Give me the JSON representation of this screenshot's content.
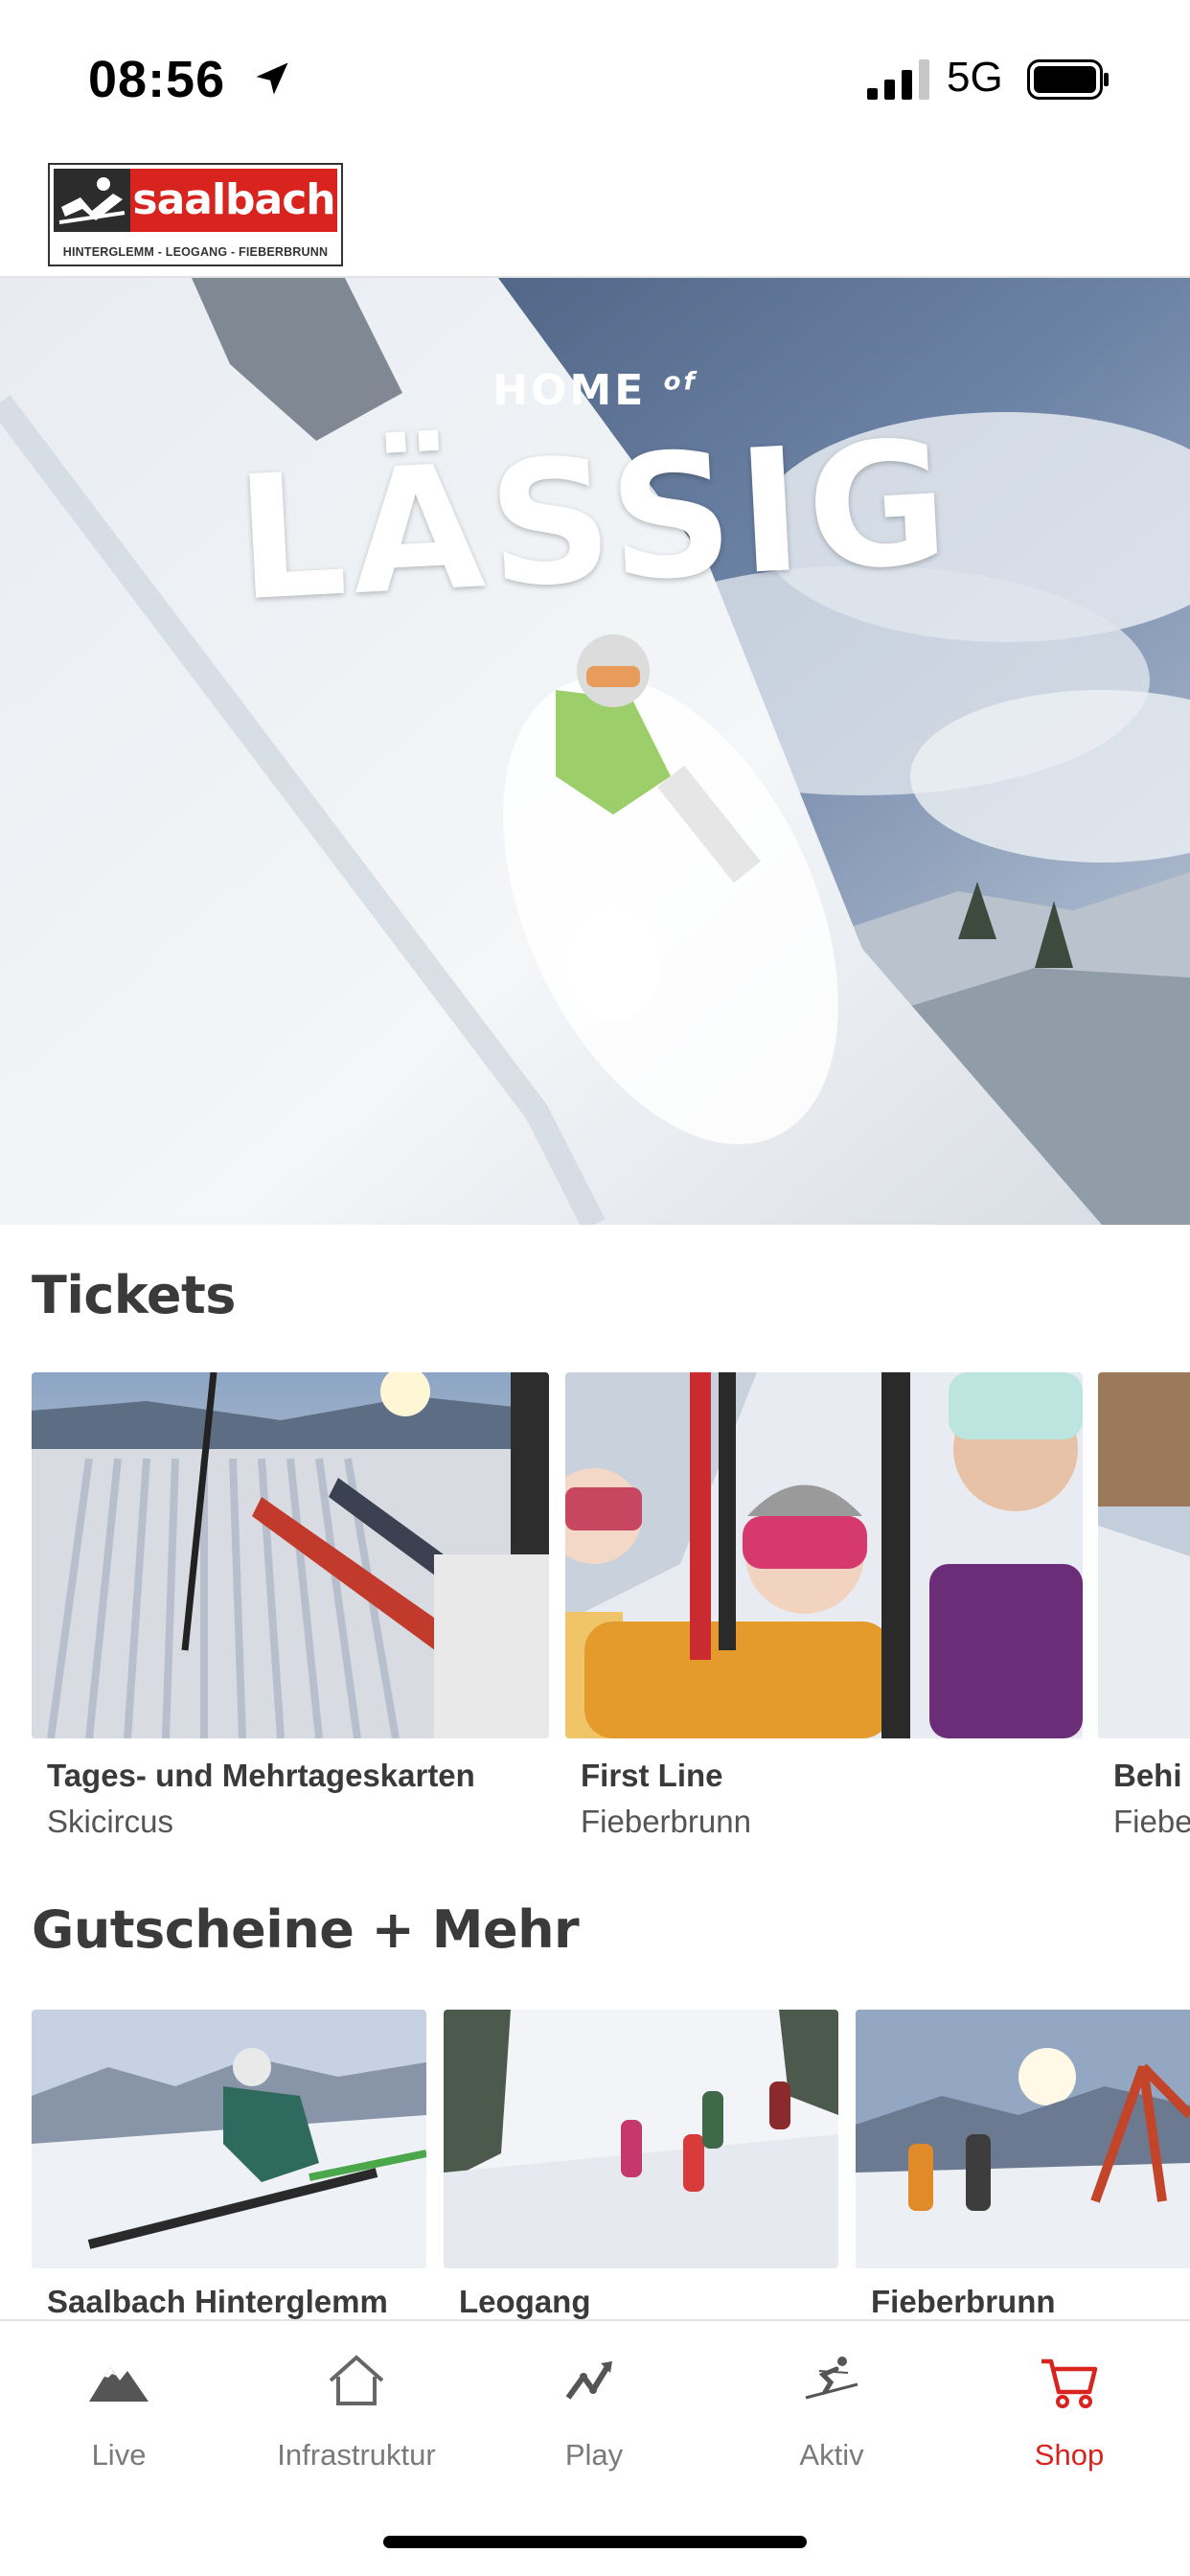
{
  "status_bar": {
    "time": "08:56",
    "network": "5G"
  },
  "header": {
    "logo_text": "saalbach",
    "logo_subtext": "HINTERGLEMM - LEOGANG - FIEBERBRUNN"
  },
  "hero": {
    "line1": "HOME",
    "line1_small": "of",
    "line2": "LÄSSIG"
  },
  "tickets": {
    "title": "Tickets",
    "cards": [
      {
        "title": "Tages- und Mehrtageskarten",
        "subtitle": "Skicircus"
      },
      {
        "title": "First Line",
        "subtitle": "Fieberbrunn"
      },
      {
        "title": "Behi",
        "subtitle": "Fiebe"
      }
    ]
  },
  "vouchers": {
    "title": "Gutscheine + Mehr",
    "cards": [
      {
        "title": "Saalbach Hinterglemm"
      },
      {
        "title": "Leogang"
      },
      {
        "title": "Fieberbrunn"
      }
    ]
  },
  "bottom_nav": {
    "items": [
      {
        "label": "Live",
        "icon": "mountain-icon"
      },
      {
        "label": "Infrastruktur",
        "icon": "house-icon"
      },
      {
        "label": "Play",
        "icon": "chart-trend-icon"
      },
      {
        "label": "Aktiv",
        "icon": "skier-icon"
      },
      {
        "label": "Shop",
        "icon": "cart-icon"
      }
    ],
    "active": "Shop"
  },
  "colors": {
    "brand_red": "#d8231e",
    "inactive_gray": "#7a7a7a"
  }
}
